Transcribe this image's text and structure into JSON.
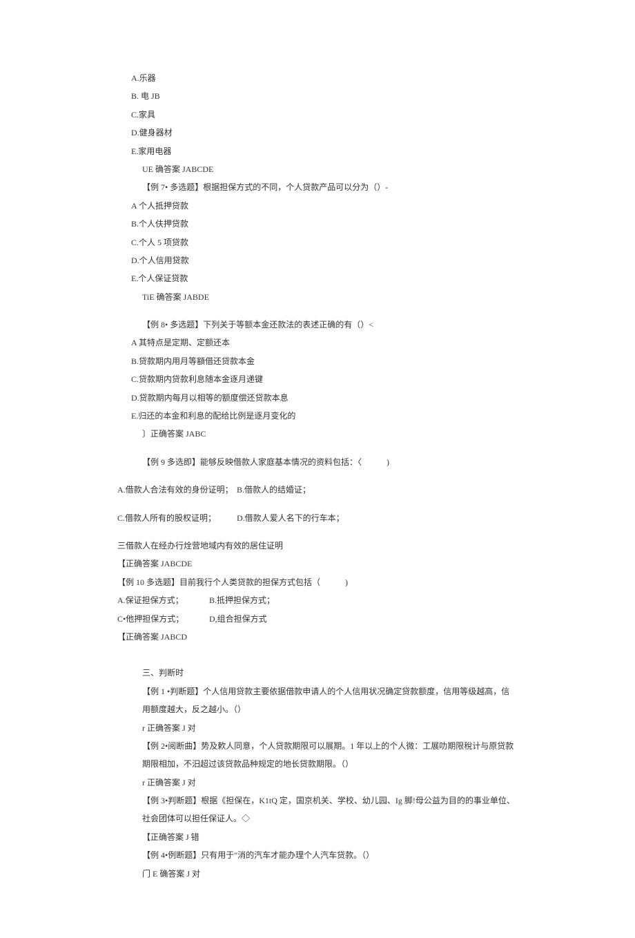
{
  "q6": {
    "optA": "A.乐器",
    "optB": "B. 电 JB",
    "optC": "C.家具",
    "optD": "D.健身器材",
    "optE": "E.家用电器",
    "answer": "UE 确答案 JABCDE"
  },
  "q7": {
    "stem": "【例 7• 多选题】根据担保方式的不同，个人贷款产品可以分为（）-",
    "optA": "A 个人抵押贷款",
    "optB": "B.个人伕押贷款",
    "optC": "C.个人 5 项贷款",
    "optD": "D.个人信用贷款",
    "optE": "E.个人保证贷款",
    "answer": "TiE 确答案 JABDE"
  },
  "q8": {
    "stem": "【例 8• 多选题】下列关于等额本金还款法的表述正确的有（）<",
    "optA": "A 其特点是定期、定额还本",
    "optB": "B.贷款期内用月等額借还贷款本金",
    "optC": "C.贷款期内贷款利息随本金逐月递键",
    "optD": "D.贷款期内每月以相等的额度偿还贷款本息",
    "optE": "E.归还的本金和利息的配给比例是逐月变化的",
    "answer": "〕正确答案 JABC"
  },
  "q9": {
    "stem": "【例 9 多选即】能够反映借款人家庭基本情况的资料包括：〈　　　)",
    "optA": "A.借款人合法有效的身份证明；",
    "optB": "B.借款人的结婚证；",
    "optC": "C.借款人所有的股权证明；",
    "optD": "D.借款人爱人名下的行车本；",
    "optE": "三借款人在经办行烇营地域内有效的居住证明",
    "answer": "【正确答案 JABCDE"
  },
  "q10": {
    "stem": "【例 10 多选题】目前我行个人类贷款的担保方式包括（　　　)",
    "optA": "A.保证担保方式；",
    "optB": "B.抵押担保方式；",
    "optC": "C•他押担保方式；",
    "optD": "D,组合担保方式",
    "answer": "【正确答案 JABCD"
  },
  "section3": "三、判断时",
  "t1": {
    "stem": "【例 1 •判断题】个人信用贷款主要依据借款申请人的个人信用状况确定贷款额度，信用等级越高，信用额度越大，反之越小。（）",
    "answer": "r 正确答案 J 对"
  },
  "t2": {
    "stem": "【例 2•阅断曲】势及欶人同意，个人贷款期限可以展期。1 年以上的个人微：工展叻期限稅计与原贷款期限相加，不汨超过该贷款品种规定的地长贷款期限。（）",
    "answer": "r 正确答案 J 对"
  },
  "t3": {
    "stem": "【例 3•判断题】根据《担保在，K1tQ 定，国京机关、学校、幼儿园、Ig 脚!母公益为目的的事业单位、社会团体可以担任保证人。◇",
    "answer": "【正确答案 J 错"
  },
  "t4": {
    "stem": "【例 4•例断题】只有用于\"消的汽车才能办理个人汽车贷款。（）",
    "answer": "门 E 确答案 J 对"
  }
}
